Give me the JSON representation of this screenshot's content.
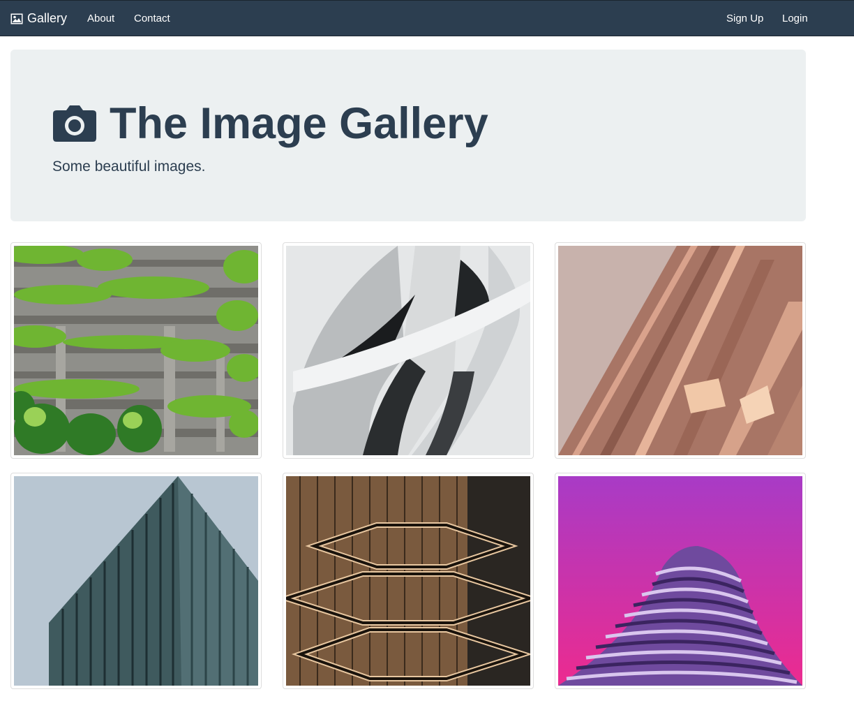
{
  "navbar": {
    "brand": {
      "label": "Gallery",
      "icon": "image-icon"
    },
    "links": [
      {
        "label": "About"
      },
      {
        "label": "Contact"
      }
    ],
    "right_links": [
      {
        "label": "Sign Up"
      },
      {
        "label": "Login"
      }
    ],
    "colors": {
      "background": "#2c3e50",
      "text": "#ffffff"
    }
  },
  "hero": {
    "icon": "camera-icon",
    "title": "The Image Gallery",
    "subtitle": "Some beautiful images.",
    "colors": {
      "background": "#ecf0f1",
      "text": "#2c3e50"
    }
  },
  "gallery": {
    "images": [
      {
        "subject": "green-terraced-building-image"
      },
      {
        "subject": "white-curved-facade-image"
      },
      {
        "subject": "copper-building-underside-image"
      },
      {
        "subject": "glass-office-tower-image"
      },
      {
        "subject": "vessel-staircase-structure-image"
      },
      {
        "subject": "purple-round-tower-image"
      }
    ]
  }
}
